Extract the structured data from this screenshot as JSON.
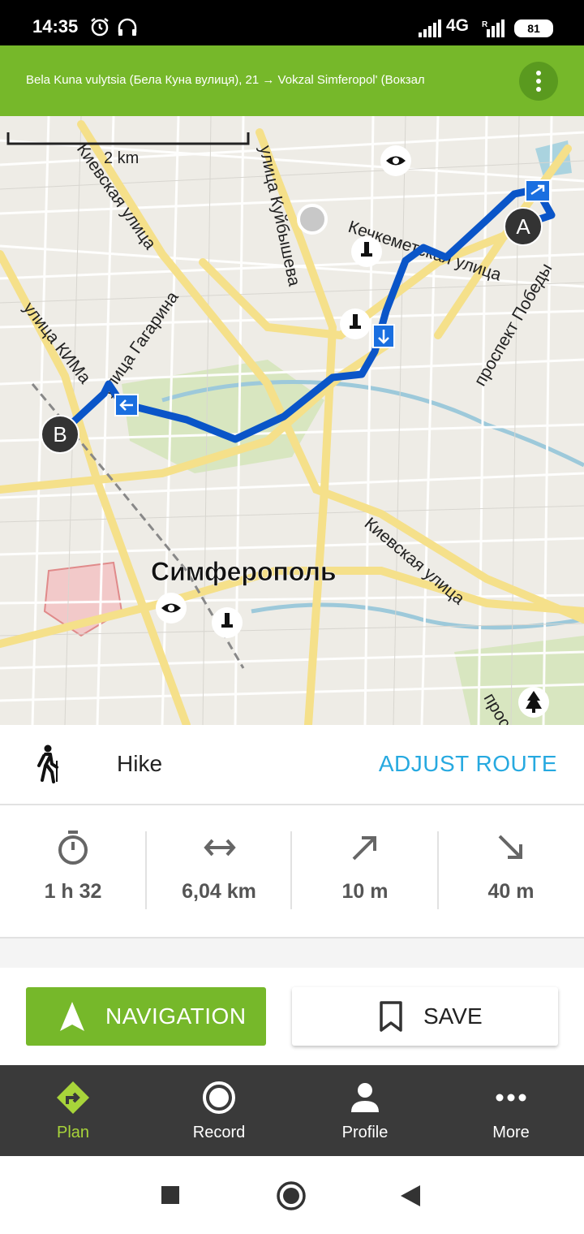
{
  "status_bar": {
    "time": "14:35",
    "network": "4G",
    "battery": "81"
  },
  "header": {
    "title": "Bela Kuna vulytsia (Бела Куна вулиця), 21 → Vokzal Simferopol' (Вокзал"
  },
  "map": {
    "scale_label": "2 km",
    "city_label": "Симферополь",
    "street_labels": {
      "kievskaya_top": "Киевская улица",
      "kuibysheva": "улица Куйбышева",
      "kechkemet": "Кечкеметская улица",
      "pobedy": "проспект Победы",
      "kima": "улица КИМа",
      "gagarina": "улица Гагарина",
      "kievskaya_bottom": "Киевская улица",
      "prosp_partial": "прос"
    },
    "start_marker": "A",
    "end_marker": "B",
    "route_color": "#0a55c8"
  },
  "route": {
    "mode_icon": "hiker-icon",
    "mode_label": "Hike",
    "adjust_label": "ADJUST ROUTE",
    "stats": [
      {
        "icon": "stopwatch-icon",
        "value": "1 h 32"
      },
      {
        "icon": "distance-arrows-icon",
        "value": "6,04 km"
      },
      {
        "icon": "ascent-arrow-icon",
        "value": "10 m"
      },
      {
        "icon": "descent-arrow-icon",
        "value": "40 m"
      }
    ]
  },
  "actions": {
    "navigation_label": "NAVIGATION",
    "save_label": "SAVE"
  },
  "tabs": [
    {
      "label": "Plan",
      "icon": "plan-route-icon",
      "active": true
    },
    {
      "label": "Record",
      "icon": "record-icon",
      "active": false
    },
    {
      "label": "Profile",
      "icon": "profile-icon",
      "active": false
    },
    {
      "label": "More",
      "icon": "more-dots-icon",
      "active": false
    }
  ],
  "colors": {
    "brand_green": "#76b82a",
    "accent_blue": "#26a9e0",
    "active_tab": "#a8d43a",
    "tabbar_bg": "#3a3a3a"
  }
}
